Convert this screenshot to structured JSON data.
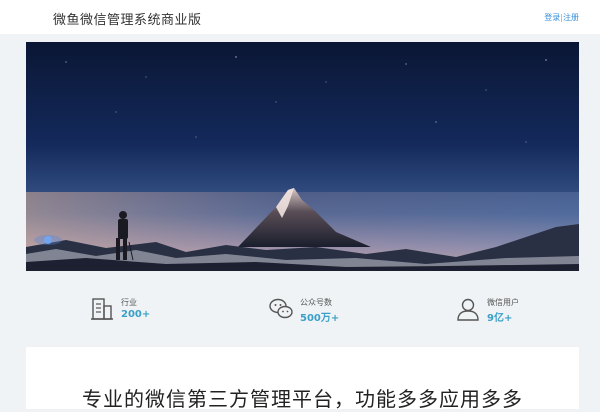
{
  "header": {
    "site_title": "微鱼微信管理系统商业版",
    "login_label": "登录",
    "separator": "|",
    "register_label": "注册"
  },
  "stats": [
    {
      "label": "行业",
      "value": "200+",
      "icon": "building-icon"
    },
    {
      "label": "公众号数",
      "value": "500万+",
      "icon": "wechat-icon"
    },
    {
      "label": "微信用户",
      "value": "9亿+",
      "icon": "user-icon"
    }
  ],
  "main": {
    "slogan": "专业的微信第三方管理平台，功能多多应用多多"
  },
  "colors": {
    "accent": "#3ba0c8",
    "link": "#3a8fd8",
    "background": "#f0f3f5"
  }
}
